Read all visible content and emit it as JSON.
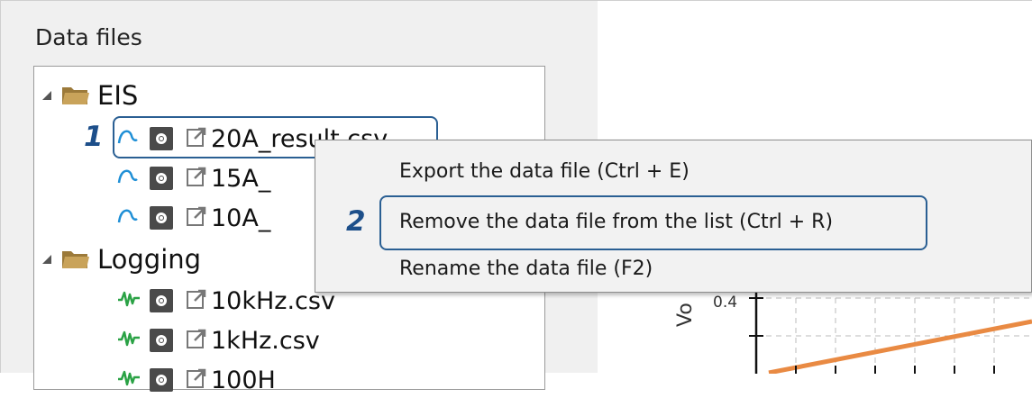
{
  "panel": {
    "title": "Data files"
  },
  "tree": {
    "groups": [
      {
        "name": "EIS",
        "files": [
          {
            "name": "20A_result.csv",
            "type_icon": "eis-arc-icon"
          },
          {
            "name": "15A_",
            "type_icon": "eis-arc-icon"
          },
          {
            "name": "10A_",
            "type_icon": "eis-arc-icon"
          }
        ]
      },
      {
        "name": "Logging",
        "files": [
          {
            "name": "10kHz.csv",
            "type_icon": "waveform-icon"
          },
          {
            "name": "1kHz.csv",
            "type_icon": "waveform-icon"
          },
          {
            "name": "100H",
            "type_icon": "waveform-icon"
          }
        ]
      }
    ]
  },
  "context_menu": {
    "items": [
      {
        "label": "Export the data file (Ctrl + E)"
      },
      {
        "label": "Remove the data file from the list (Ctrl + R)"
      },
      {
        "label": "Rename the data file (F2)"
      }
    ]
  },
  "callouts": {
    "step1": "1",
    "step2": "2"
  },
  "chart": {
    "ylabel": "Vo",
    "tick": "0.4",
    "line_color": "#e98a43"
  },
  "colors": {
    "folder": "#b8924a",
    "eis_icon": "#1f8fd6",
    "waveform_icon": "#2aa245",
    "highlight": "#2a5f93",
    "callout": "#1d4f8a"
  }
}
